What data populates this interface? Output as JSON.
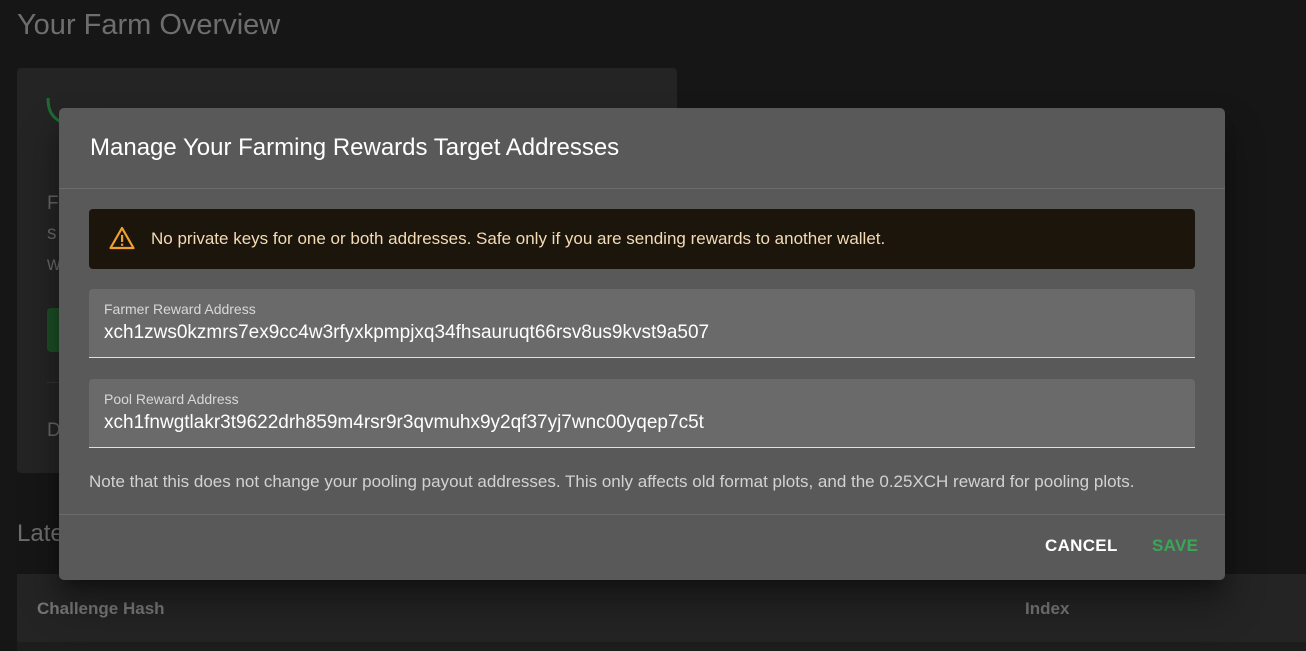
{
  "background": {
    "page_title": "Your Farm Overview",
    "card_fragments": [
      "F",
      "s",
      "w",
      "D"
    ],
    "section_title_fragment": "Late",
    "table_headers": [
      "Challenge Hash",
      "Index"
    ]
  },
  "dialog": {
    "title": "Manage Your Farming Rewards Target Addresses",
    "alert": {
      "icon": "warning-icon",
      "text": "No private keys for one or both addresses. Safe only if you are sending rewards to another wallet.",
      "color": "#f3dbb6"
    },
    "farmer_field": {
      "label": "Farmer Reward Address",
      "value": "xch1zws0kzmrs7ex9cc4w3rfyxkpmpjxq34fhsauruqt66rsv8us9kvst9a507"
    },
    "pool_field": {
      "label": "Pool Reward Address",
      "value": "xch1fnwgtlakr3t9622drh859m4rsr9r3qvmuhx9y2qf37yj7wnc00yqep7c5t"
    },
    "note": "Note that this does not change your pooling payout addresses. This only affects old format plots, and the 0.25XCH reward for pooling plots.",
    "buttons": {
      "cancel": "CANCEL",
      "save": "SAVE"
    },
    "accent_color": "#3aa756"
  }
}
